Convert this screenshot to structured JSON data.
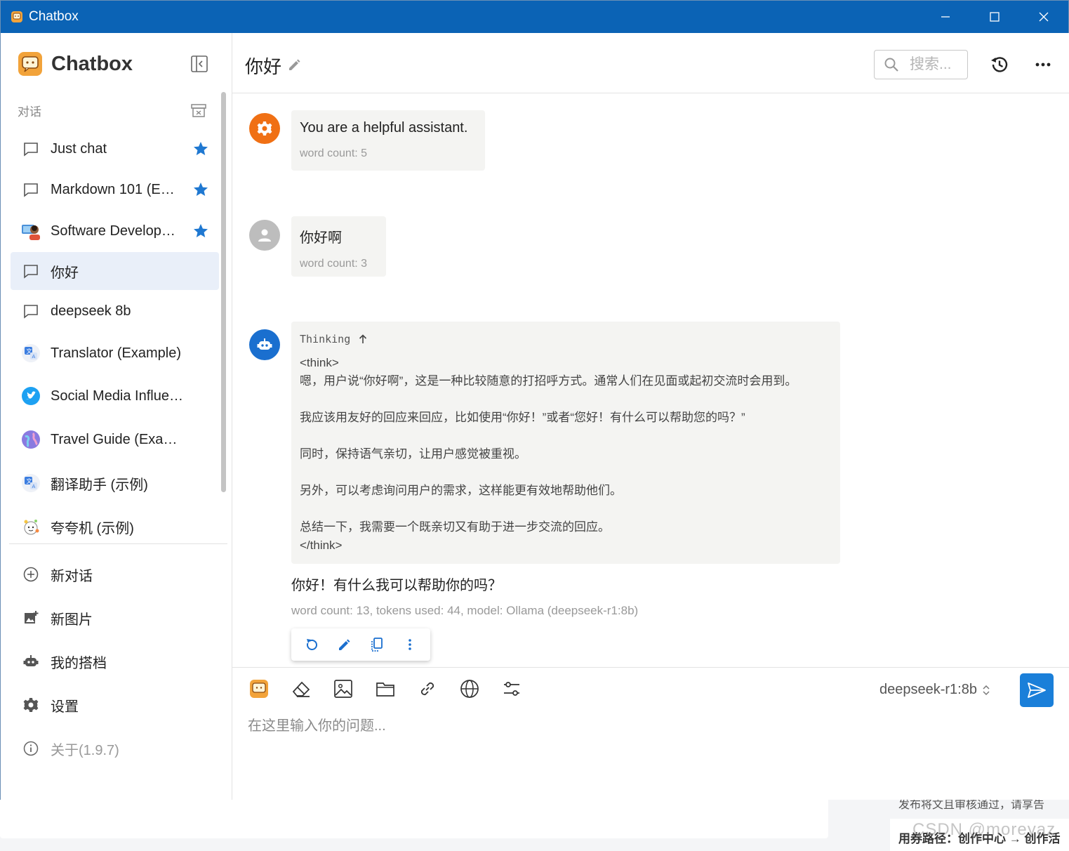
{
  "window": {
    "title": "Chatbox"
  },
  "sidebar": {
    "brand": "Chatbox",
    "section_label": "对话",
    "conversations": [
      {
        "label": "Just chat",
        "icon": "chat-bubble-icon",
        "starred": true,
        "active": false
      },
      {
        "label": "Markdown 101 (E…",
        "icon": "chat-bubble-icon",
        "starred": true,
        "active": false
      },
      {
        "label": "Software Develop…",
        "icon": "developer-avatar-icon",
        "starred": true,
        "active": false
      },
      {
        "label": "你好",
        "icon": "chat-bubble-icon",
        "starred": false,
        "active": true
      },
      {
        "label": "deepseek 8b",
        "icon": "chat-bubble-icon",
        "starred": false,
        "active": false
      },
      {
        "label": "Translator (Example)",
        "icon": "translate-avatar-icon",
        "starred": false,
        "active": false
      },
      {
        "label": "Social Media Influence…",
        "icon": "twitter-avatar-icon",
        "starred": false,
        "active": false
      },
      {
        "label": "Travel Guide (Example)",
        "icon": "globe-avatar-icon",
        "starred": false,
        "active": false
      },
      {
        "label": "翻译助手 (示例)",
        "icon": "translate-avatar-icon",
        "starred": false,
        "active": false
      },
      {
        "label": "夸夸机 (示例)",
        "icon": "cheer-avatar-icon",
        "starred": false,
        "active": false
      }
    ],
    "menu": {
      "new_chat": "新对话",
      "new_image": "新图片",
      "my_copilots": "我的搭档",
      "settings": "设置",
      "about": "关于(1.9.7)"
    }
  },
  "header": {
    "title": "你好",
    "search_placeholder": "搜索..."
  },
  "messages": {
    "system": {
      "text": "You are a helpful assistant.",
      "meta": "word count: 5"
    },
    "user": {
      "text": "你好啊",
      "meta": "word count: 3"
    },
    "assistant": {
      "thinking_label": "Thinking",
      "think_lines": [
        "<think>",
        "嗯，用户说“你好啊”，这是一种比较随意的打招呼方式。通常人们在见面或起初交流时会用到。",
        "",
        "我应该用友好的回应来回应，比如使用“你好！”或者“您好！有什么可以帮助您的吗？”",
        "",
        "同时，保持语气亲切，让用户感觉被重视。",
        "",
        "另外，可以考虑询问用户的需求，这样能更有效地帮助他们。",
        "",
        "总结一下，我需要一个既亲切又有助于进一步交流的回应。",
        "</think>"
      ],
      "answer": "你好！有什么我可以帮助你的吗？",
      "meta": "word count: 13, tokens used: 44, model: Ollama (deepseek-r1:8b)"
    }
  },
  "composer": {
    "model": "deepseek-r1:8b",
    "placeholder": "在这里输入你的问题..."
  },
  "background": {
    "line1": "发布将文且审核通过，请享告",
    "line2": "用券路径：创作中心 → 创作活",
    "watermark": "CSDN @moreyaz"
  },
  "colors": {
    "titlebar": "#0b63b5",
    "accent": "#1a7fd9",
    "star": "#1f78d1",
    "system_avatar": "#f07014",
    "user_avatar": "#bdbdbd",
    "assistant_avatar": "#1a6fcf"
  }
}
